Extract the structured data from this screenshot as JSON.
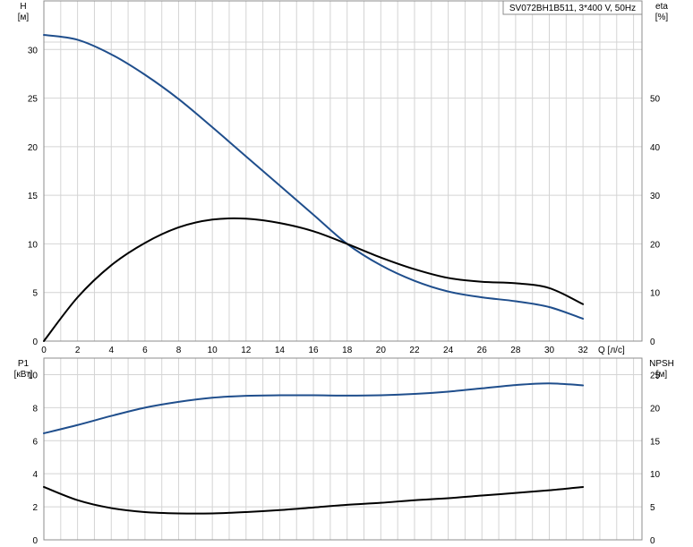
{
  "chart_data": [
    {
      "type": "line",
      "panel": "top",
      "title": "SV072BH1B511, 3*400 V, 50Hz",
      "xlabel": "Q [л/с]",
      "x_ticks": [
        "0",
        "2",
        "4",
        "6",
        "8",
        "10",
        "12",
        "14",
        "16",
        "18",
        "20",
        "22",
        "24",
        "26",
        "28",
        "30",
        "32"
      ],
      "xlim": [
        0,
        35.5
      ],
      "left_axis": {
        "label_line1": "H",
        "label_line2": "[м]",
        "ylim": [
          0,
          35
        ],
        "ticks": [
          "0",
          "5",
          "10",
          "15",
          "20",
          "25",
          "30"
        ]
      },
      "right_axis": {
        "label_line1": "eta",
        "label_line2": "[%]",
        "ylim": [
          0,
          70
        ],
        "ticks": [
          "0",
          "10",
          "20",
          "30",
          "40",
          "50"
        ]
      },
      "grid": true,
      "series": [
        {
          "axis": "left",
          "color": "#1f4e8c",
          "x": [
            0,
            2,
            4,
            6,
            8,
            10,
            12,
            14,
            16,
            18,
            20,
            22,
            24,
            26,
            28,
            30,
            32
          ],
          "y": [
            31.5,
            31.0,
            29.5,
            27.4,
            24.9,
            22.0,
            19.0,
            16.0,
            13.0,
            10.0,
            7.8,
            6.2,
            5.1,
            4.5,
            4.1,
            3.5,
            2.3
          ]
        },
        {
          "axis": "right",
          "color": "#000000",
          "x": [
            0,
            2,
            4,
            6,
            8,
            10,
            12,
            14,
            16,
            18,
            20,
            22,
            24,
            26,
            28,
            30,
            32
          ],
          "y": [
            0,
            9.0,
            15.6,
            20.2,
            23.4,
            25.0,
            25.2,
            24.3,
            22.6,
            20.0,
            17.2,
            14.8,
            13.0,
            12.2,
            11.9,
            10.9,
            7.6
          ]
        }
      ]
    },
    {
      "type": "line",
      "panel": "bottom",
      "xlim": [
        0,
        35.5
      ],
      "left_axis": {
        "label_line1": "P1",
        "label_line2": "[кВт]",
        "ylim": [
          0,
          11
        ],
        "ticks": [
          "0",
          "2",
          "4",
          "6",
          "8",
          "10"
        ]
      },
      "right_axis": {
        "label_line1": "NPSH",
        "label_line2": "[м]",
        "ylim": [
          0,
          27.5
        ],
        "ticks": [
          "0",
          "5",
          "10",
          "15",
          "20",
          "25"
        ]
      },
      "grid": true,
      "series": [
        {
          "axis": "left",
          "color": "#1f4e8c",
          "x": [
            0,
            2,
            4,
            6,
            8,
            10,
            12,
            14,
            16,
            18,
            20,
            22,
            24,
            26,
            28,
            30,
            32
          ],
          "y": [
            6.45,
            6.95,
            7.5,
            8.0,
            8.35,
            8.6,
            8.72,
            8.75,
            8.75,
            8.73,
            8.75,
            8.83,
            8.97,
            9.17,
            9.37,
            9.47,
            9.35
          ]
        },
        {
          "axis": "right",
          "color": "#000000",
          "x": [
            0,
            2,
            4,
            6,
            8,
            10,
            12,
            14,
            16,
            18,
            20,
            22,
            24,
            26,
            28,
            30,
            32
          ],
          "y": [
            8.0,
            6.0,
            4.8,
            4.2,
            4.0,
            4.0,
            4.2,
            4.5,
            4.9,
            5.3,
            5.6,
            6.0,
            6.3,
            6.7,
            7.1,
            7.5,
            8.0
          ]
        }
      ]
    }
  ]
}
